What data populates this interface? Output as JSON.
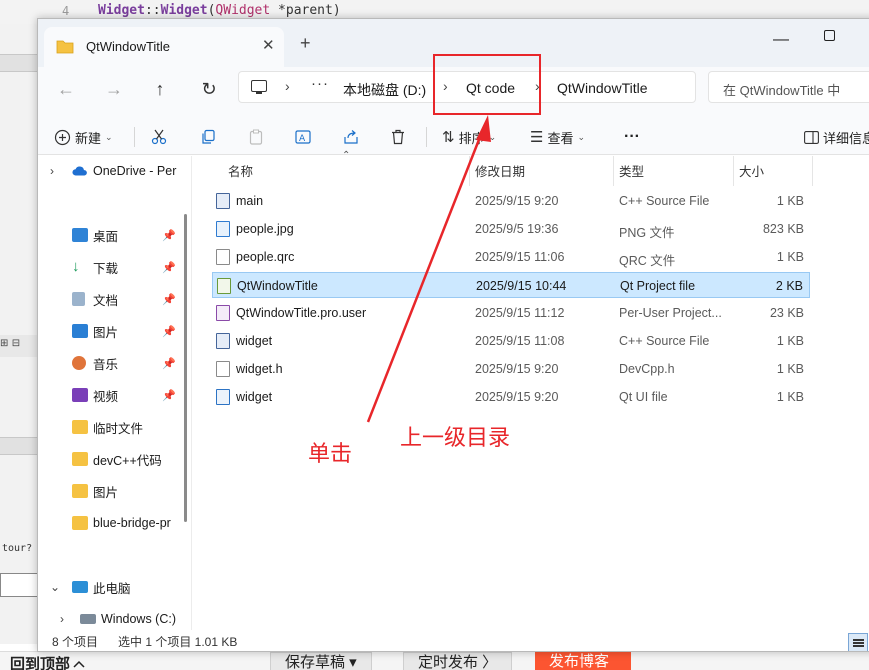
{
  "background": {
    "editor_line_number": "4",
    "editor_code_class": "Widget",
    "editor_code_scope": "::",
    "editor_code_func": "Widget",
    "editor_code_open": "(",
    "editor_code_param_type": "QWidget",
    "editor_code_rest": " *parent)",
    "left_panel_text": "tour?",
    "left_toolbar_plus": "⊞",
    "left_toolbar_box": "⊟",
    "bottom_back_to_top": "回到顶部",
    "bottom_back_to_top_icon": "chevron-up-icon",
    "bottom_save_draft": "保存草稿 ▾",
    "bottom_schedule": "定时发布 〉",
    "bottom_publish": "发布博客"
  },
  "window": {
    "tab_title": "QtWindowTitle",
    "tab_close": "✕",
    "new_tab": "+",
    "minimize": "—"
  },
  "navbar": {
    "back": "←",
    "forward": "→",
    "up": "↑",
    "refresh": "↻",
    "address": {
      "overflow": "···",
      "sep": "›",
      "crumbs": [
        "本地磁盘 (D:)",
        "Qt code",
        "QtWindowTitle"
      ]
    },
    "search_placeholder": "在 QtWindowTitle 中"
  },
  "toolbar": {
    "new_label": "新建",
    "sort_label": "排序",
    "view_label": "查看",
    "more": "···",
    "details_label": "详细信息",
    "icons": [
      "cut-icon",
      "copy-icon",
      "paste-icon",
      "rename-icon",
      "share-icon",
      "delete-icon"
    ]
  },
  "nav_pane": {
    "items": [
      {
        "label": "OneDrive - Per",
        "chevron": "›",
        "pin": false
      },
      {
        "label": "桌面",
        "chevron": "",
        "pin": true
      },
      {
        "label": "下载",
        "chevron": "",
        "pin": true
      },
      {
        "label": "文档",
        "chevron": "",
        "pin": true
      },
      {
        "label": "图片",
        "chevron": "",
        "pin": true
      },
      {
        "label": "音乐",
        "chevron": "",
        "pin": true
      },
      {
        "label": "视频",
        "chevron": "",
        "pin": true
      },
      {
        "label": "临时文件",
        "chevron": "",
        "pin": false
      },
      {
        "label": "devC++代码",
        "chevron": "",
        "pin": false
      },
      {
        "label": "图片",
        "chevron": "",
        "pin": false
      },
      {
        "label": "blue-bridge-pr",
        "chevron": "",
        "pin": false
      },
      {
        "label": "此电脑",
        "chevron": "⌄",
        "pin": false
      },
      {
        "label": "Windows (C:)",
        "chevron": "›",
        "pin": false
      }
    ],
    "pin_glyph": "📌"
  },
  "files": {
    "columns": {
      "name": "名称",
      "date": "修改日期",
      "type": "类型",
      "size": "大小"
    },
    "sort_glyph": "⌃",
    "rows": [
      {
        "name": "main",
        "date": "2025/9/15 9:20",
        "type": "C++ Source File",
        "size": "1 KB",
        "icon": "cpp"
      },
      {
        "name": "people.jpg",
        "date": "2025/9/5 19:36",
        "type": "PNG 文件",
        "size": "823 KB",
        "icon": "img"
      },
      {
        "name": "people.qrc",
        "date": "2025/9/15 11:06",
        "type": "QRC 文件",
        "size": "1 KB",
        "icon": "file"
      },
      {
        "name": "QtWindowTitle",
        "date": "2025/9/15 10:44",
        "type": "Qt Project file",
        "size": "2 KB",
        "icon": "pro",
        "selected": true
      },
      {
        "name": "QtWindowTitle.pro.user",
        "date": "2025/9/15 11:12",
        "type": "Per-User Project...",
        "size": "23 KB",
        "icon": "user"
      },
      {
        "name": "widget",
        "date": "2025/9/15 11:08",
        "type": "C++ Source File",
        "size": "1 KB",
        "icon": "cpp"
      },
      {
        "name": "widget.h",
        "date": "2025/9/15 9:20",
        "type": "DevCpp.h",
        "size": "1 KB",
        "icon": "file"
      },
      {
        "name": "widget",
        "date": "2025/9/15 9:20",
        "type": "Qt UI file",
        "size": "1 KB",
        "icon": "ui"
      }
    ]
  },
  "status": {
    "count": "8 个项目",
    "selected": "选中 1 个项目  1.01 KB"
  },
  "annotation": {
    "click_label": "单击",
    "up_level_label": "上一级目录",
    "color": "#e8262a"
  }
}
